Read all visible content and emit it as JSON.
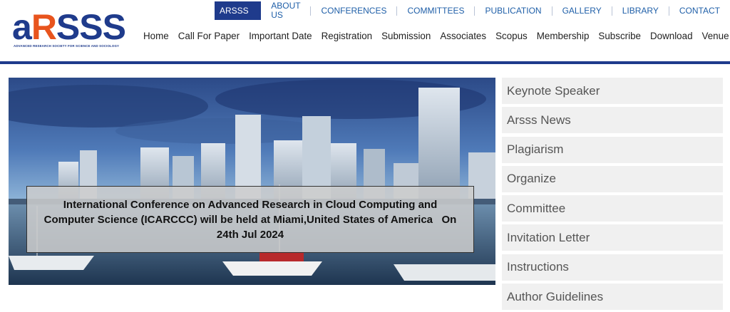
{
  "logo": {
    "text_a": "a",
    "text_r": "R",
    "text_sss": "SSS",
    "tagline": "ADVANCED RESEARCH SOCIETY FOR SCIENCE AND SOCIOLOGY"
  },
  "top_nav": {
    "home": "ARSSS Home",
    "items": [
      "ABOUT US",
      "CONFERENCES",
      "COMMITTEES",
      "PUBLICATION",
      "GALLERY",
      "LIBRARY",
      "CONTACT"
    ]
  },
  "main_nav": [
    "Home",
    "Call For Paper",
    "Important Date",
    "Registration",
    "Submission",
    "Associates",
    "Scopus",
    "Membership",
    "Subscribe",
    "Download",
    "Venue"
  ],
  "hero": {
    "caption": "International Conference on Advanced Research in Cloud Computing and Computer Science (ICARCCC) will be held at Miami,United States of America   On 24th Jul 2024"
  },
  "sidebar": [
    "Keynote Speaker",
    "Arsss News",
    "Plagiarism",
    "Organize",
    "Committee",
    "Invitation Letter",
    "Instructions",
    "Author Guidelines"
  ],
  "colors": {
    "brand_blue": "#1f3b8c",
    "brand_orange": "#e8541d",
    "link_blue": "#1f5fa8"
  }
}
